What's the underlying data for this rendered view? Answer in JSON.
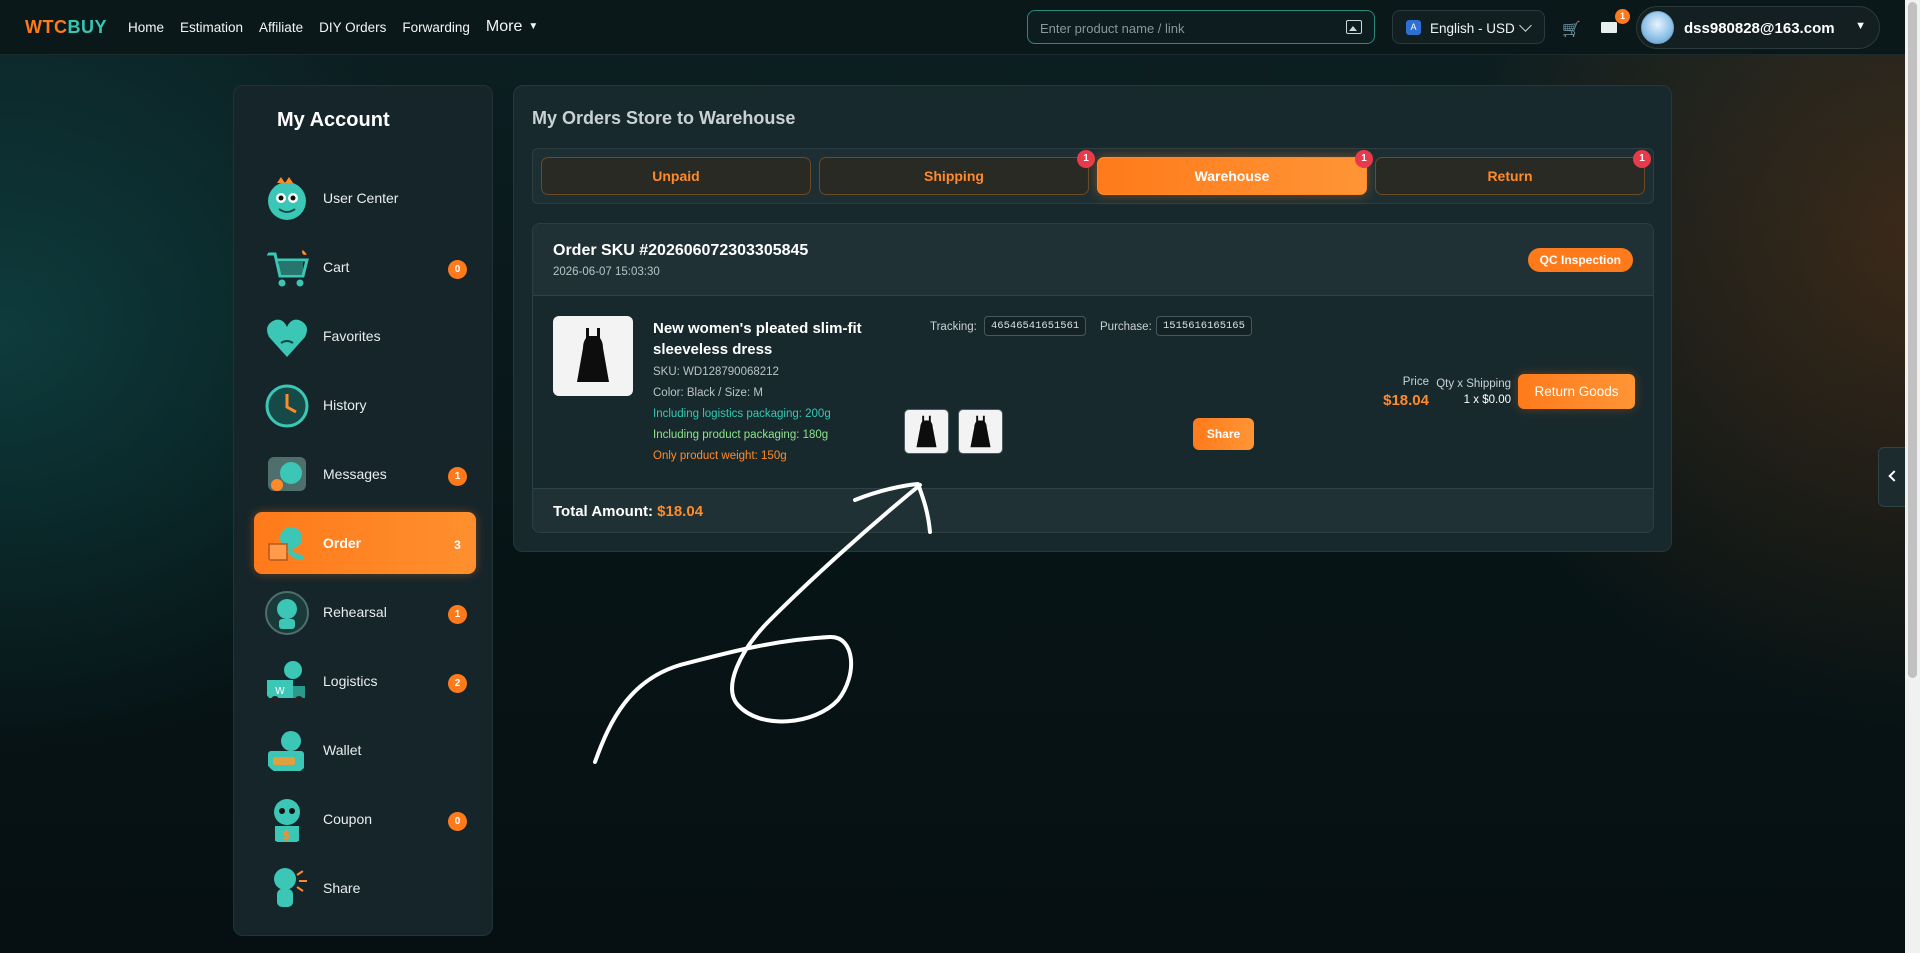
{
  "topnav": {
    "logo_part1": "WTC",
    "logo_part2": "BUY",
    "links": [
      "Home",
      "Estimation",
      "Affiliate",
      "DIY Orders",
      "Forwarding"
    ],
    "more_label": "More",
    "search_placeholder": "Enter product name / link",
    "language": "English - USD",
    "mail_badge": "1",
    "user_email": "dss980828@163.com"
  },
  "sidebar": {
    "title": "My Account",
    "items": [
      {
        "label": "User Center",
        "icon": "dino-mascot-icon",
        "badge": ""
      },
      {
        "label": "Cart",
        "icon": "cart-icon",
        "badge": "0"
      },
      {
        "label": "Favorites",
        "icon": "heart-icon",
        "badge": ""
      },
      {
        "label": "History",
        "icon": "clock-icon",
        "badge": ""
      },
      {
        "label": "Messages",
        "icon": "message-icon",
        "badge": "1"
      },
      {
        "label": "Order",
        "icon": "order-box-icon",
        "badge": "3"
      },
      {
        "label": "Rehearsal",
        "icon": "rehearsal-icon",
        "badge": "1"
      },
      {
        "label": "Logistics",
        "icon": "truck-icon",
        "badge": "2"
      },
      {
        "label": "Wallet",
        "icon": "wallet-icon",
        "badge": ""
      },
      {
        "label": "Coupon",
        "icon": "coupon-icon",
        "badge": "0"
      },
      {
        "label": "Share",
        "icon": "share-icon",
        "badge": ""
      }
    ],
    "active_index": 5
  },
  "main": {
    "heading": "My Orders Store to Warehouse",
    "tabs": [
      {
        "label": "Unpaid",
        "badge": ""
      },
      {
        "label": "Shipping",
        "badge": "1"
      },
      {
        "label": "Warehouse",
        "badge": "1"
      },
      {
        "label": "Return",
        "badge": "1"
      }
    ],
    "active_tab": 2,
    "order": {
      "title": "Order SKU #202606072303305845",
      "date": "2026-06-07 15:03:30",
      "status": "QC Inspection",
      "product_name": "New women's pleated slim-fit sleeveless dress",
      "sku": "SKU: WD128790068212",
      "color_size": "Color: Black / Size: M",
      "pack_logistics": "Including logistics packaging: 200g",
      "pack_product": "Including product packaging: 180g",
      "weight": "Only product weight: 150g",
      "tracking_label": "Tracking:",
      "tracking_value": "465465416515​61",
      "purchase_label": "Purchase:",
      "purchase_value": "15156161651​65",
      "share_label": "Share",
      "price_label": "Price",
      "price_value": "$18.04",
      "qty_label": "Qty x Shipping",
      "qty_value": "1 x $0.00",
      "return_label": "Return Goods",
      "total_label": "Total Amount:",
      "total_value": "$18.04"
    }
  },
  "colors": {
    "accent": "#ff7a1a",
    "teal": "#36c7b3",
    "badge_red": "#e83a4a"
  }
}
